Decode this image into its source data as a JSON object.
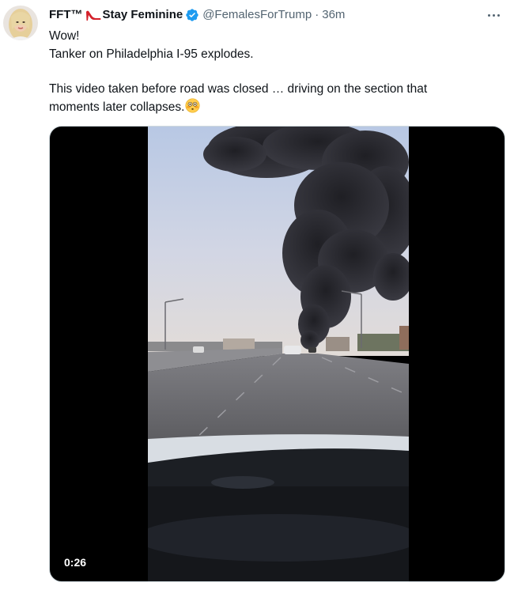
{
  "author": {
    "display_name": "FFT™",
    "display_name_emoji": "high-heel-icon",
    "display_name_suffix": "Stay Feminine",
    "handle": "@FemalesForTrump",
    "separator": "·",
    "timestamp": "36m",
    "verified": true
  },
  "tweet": {
    "lines": [
      "Wow!",
      "Tanker on Philadelphia I-95 explodes.",
      "This video taken before road was closed … driving on the section that",
      "moments later collapses."
    ],
    "emoji": "flushed-face-icon"
  },
  "media": {
    "type": "video",
    "duration": "0:26"
  },
  "colors": {
    "text_primary": "#0f1419",
    "text_secondary": "#536471",
    "verified_blue": "#1d9bf0",
    "heel_red": "#d4202a",
    "media_border": "#cfd9de"
  }
}
